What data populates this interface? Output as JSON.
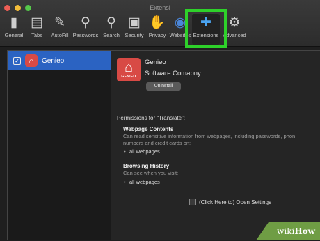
{
  "window": {
    "title": "Extensi",
    "traffic_light_colors": [
      "#ee5e55",
      "#f3bd3a",
      "#55c84a"
    ]
  },
  "toolbar": {
    "items": [
      {
        "label": "General",
        "icon": "switch-icon"
      },
      {
        "label": "Tabs",
        "icon": "tabs-icon"
      },
      {
        "label": "AutoFill",
        "icon": "pencil-icon"
      },
      {
        "label": "Passwords",
        "icon": "key-icon"
      },
      {
        "label": "Search",
        "icon": "search-icon"
      },
      {
        "label": "Security",
        "icon": "lock-icon"
      },
      {
        "label": "Privacy",
        "icon": "hand-icon"
      },
      {
        "label": "Websites",
        "icon": "globe-icon"
      },
      {
        "label": "Extensions",
        "icon": "puzzle-icon",
        "selected": true
      },
      {
        "label": "Advanced",
        "icon": "gear-icon"
      }
    ],
    "highlight_color": "#2ed12a"
  },
  "sidebar": {
    "items": [
      {
        "label": "Genieo",
        "checked": true,
        "selected": true
      }
    ],
    "selected_color": "#2b63c2"
  },
  "extension": {
    "logo_text": "GENIEO",
    "name": "Genieo",
    "company": "Software Comapny",
    "uninstall_label": "Uninstall",
    "brand_color": "#d84a45"
  },
  "permissions": {
    "title": "Permissions for “Translate”:",
    "webpage_contents": {
      "heading": "Webpage Contents",
      "description": "Can read sensitive information from webpages, including passwords, phon\nnumbers and credit cards on:",
      "bullet": "all webpages"
    },
    "browsing_history": {
      "heading": "Browsing History",
      "description": "Can see when you visit:",
      "bullet": "all webpages"
    }
  },
  "settings": {
    "label": "(Click Here to) Open Settings",
    "checked": false
  },
  "watermark": {
    "part1": "wiki",
    "part2": "How",
    "color": "#6f9d44"
  }
}
